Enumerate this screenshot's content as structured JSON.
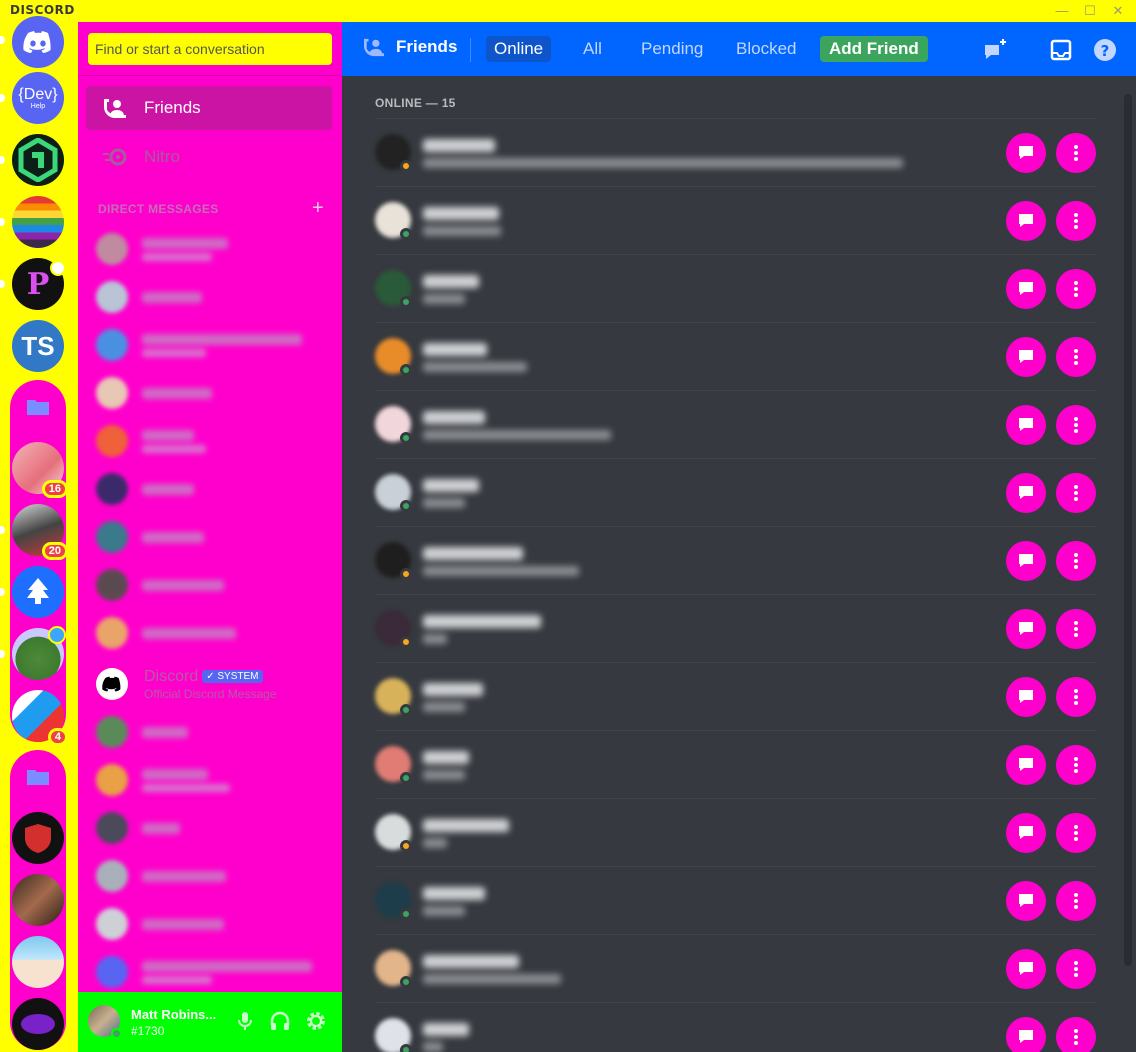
{
  "app": {
    "logo": "DISCORD",
    "window_controls": [
      "—",
      "☐",
      "✕"
    ]
  },
  "server_rail": {
    "servers": [
      {
        "name": "home",
        "label": "",
        "color": "#5865f2"
      },
      {
        "name": "dev-help",
        "label": "{Dev}",
        "sub": "Help",
        "color": "#5865f2"
      },
      {
        "name": "green-hex",
        "label": "",
        "color": "#111111"
      },
      {
        "name": "rainbow",
        "label": "",
        "color": "#7a3a6a"
      },
      {
        "name": "p-server",
        "label": "P",
        "color": "#111111"
      },
      {
        "name": "ts-server",
        "label": "TS",
        "color": "#3178c6"
      }
    ],
    "folder1_badges": [
      "16",
      "20"
    ],
    "folder2_badge": "4"
  },
  "search": {
    "placeholder": "Find or start a conversation"
  },
  "nav": {
    "friends": "Friends",
    "nitro": "Nitro"
  },
  "dm_section": {
    "header": "DIRECT MESSAGES",
    "add": "+"
  },
  "system_dm": {
    "name": "Discord",
    "tag": "✓ SYSTEM",
    "sub": "Official Discord Message"
  },
  "user": {
    "name": "Matt Robins...",
    "tag": "#1730"
  },
  "topbar": {
    "title": "Friends",
    "tabs": [
      "Online",
      "All",
      "Pending",
      "Blocked"
    ],
    "add_friend": "Add Friend"
  },
  "online_header": "ONLINE — 15",
  "colors": {
    "rail": "#ffff00",
    "sidebar": "#ff00cc",
    "topbar": "#0066ff",
    "userpanel": "#00ff00",
    "action_buttons": "#ff00cc",
    "main_bg": "#36393f"
  }
}
